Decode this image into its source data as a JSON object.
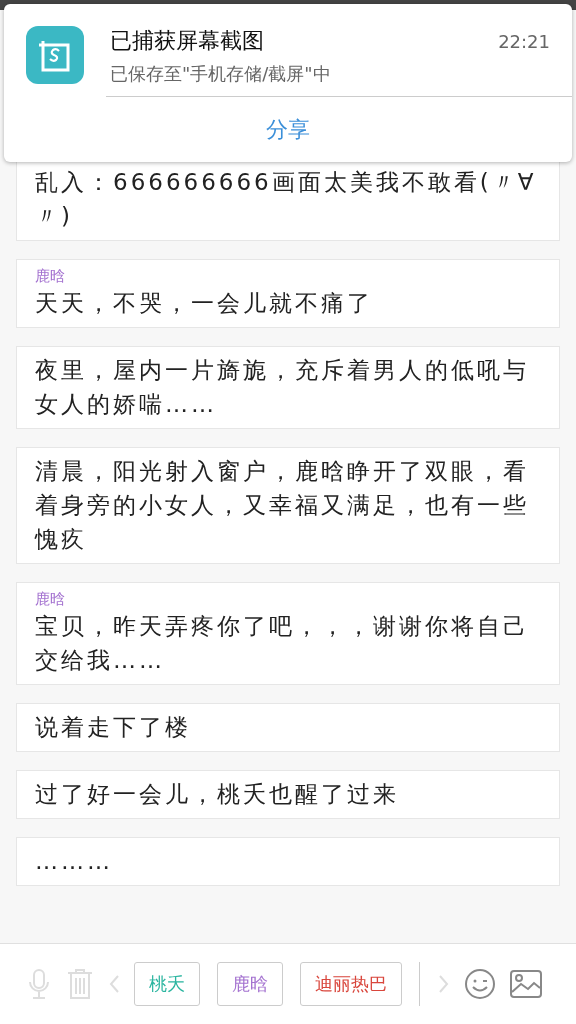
{
  "notification": {
    "title": "已捕获屏幕截图",
    "subtitle": "已保存至\"手机存储/截屏\"中",
    "time": "22:21",
    "action": "分享"
  },
  "messages": [
    {
      "text": "乱入：666666666画面太美我不敢看(〃∀〃)"
    },
    {
      "speaker": "鹿晗",
      "text": "天天，不哭，一会儿就不痛了"
    },
    {
      "text": "夜里，屋内一片旖旎，充斥着男人的低吼与女人的娇喘……"
    },
    {
      "text": "清晨，阳光射入窗户，鹿晗睁开了双眼，看着身旁的小女人，又幸福又满足，也有一些愧疚"
    },
    {
      "speaker": "鹿晗",
      "text": "宝贝，昨天弄疼你了吧，，，谢谢你将自己交给我……"
    },
    {
      "text": "说着走下了楼"
    },
    {
      "text": "过了好一会儿，桃夭也醒了过来"
    },
    {
      "text": "………"
    }
  ],
  "characters": [
    {
      "name": "桃夭",
      "color": "#2bb5a0"
    },
    {
      "name": "鹿晗",
      "color": "#a472d0"
    },
    {
      "name": "迪丽热巴",
      "color": "#d9463c"
    }
  ]
}
